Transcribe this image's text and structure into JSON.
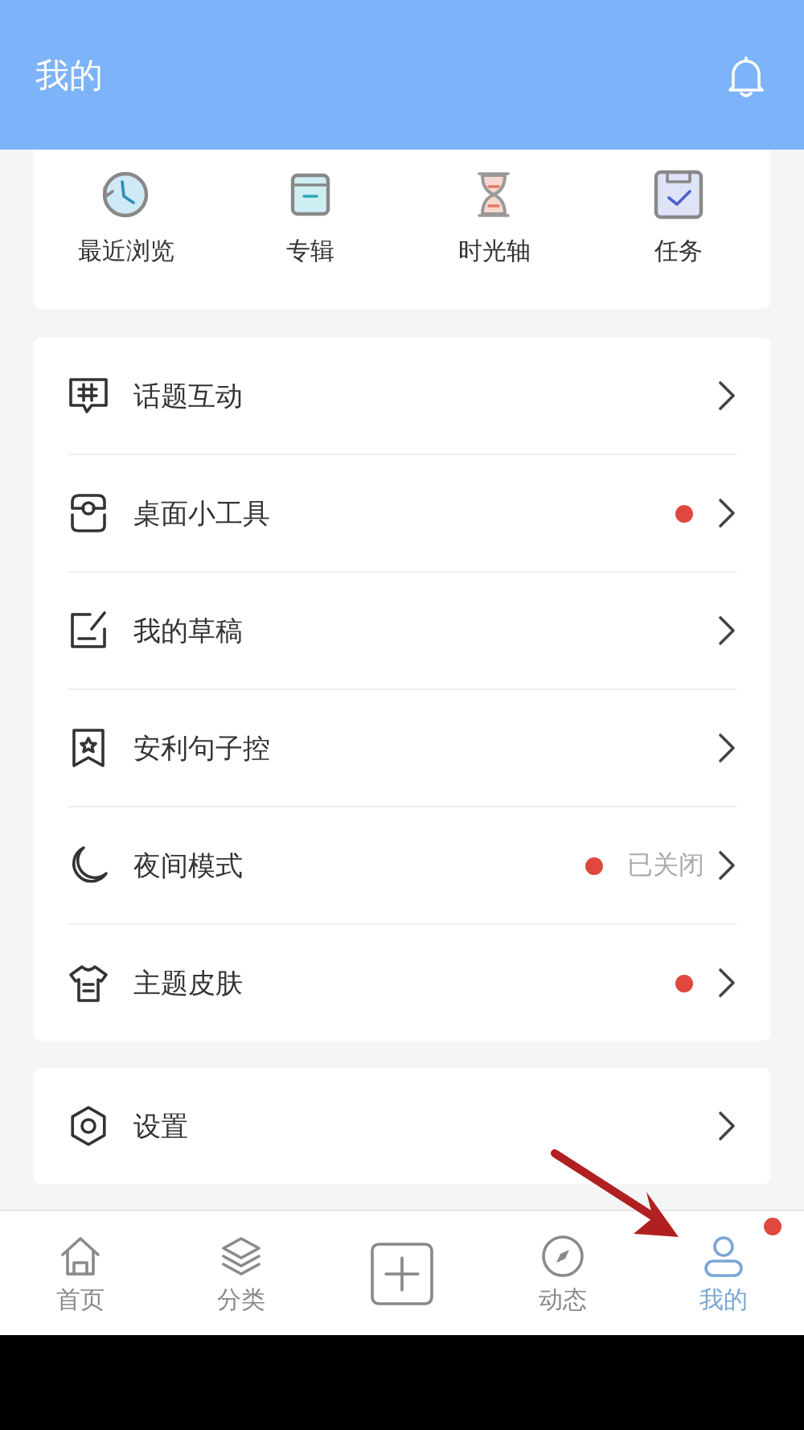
{
  "header": {
    "title": "我的"
  },
  "shortcuts": [
    {
      "label": "最近浏览",
      "kind": "history"
    },
    {
      "label": "专辑",
      "kind": "album"
    },
    {
      "label": "时光轴",
      "kind": "hourglass"
    },
    {
      "label": "任务",
      "kind": "task"
    }
  ],
  "menu": [
    {
      "label": "话题互动",
      "kind": "topic",
      "dot": false
    },
    {
      "label": "桌面小工具",
      "kind": "widget",
      "dot": true
    },
    {
      "label": "我的草稿",
      "kind": "draft",
      "dot": false
    },
    {
      "label": "安利句子控",
      "kind": "bookmark",
      "dot": false
    },
    {
      "label": "夜间模式",
      "kind": "moon",
      "dot": true,
      "status": "已关闭"
    },
    {
      "label": "主题皮肤",
      "kind": "shirt",
      "dot": true
    }
  ],
  "settings": [
    {
      "label": "设置",
      "kind": "gear",
      "dot": false
    }
  ],
  "tabs": [
    {
      "label": "首页",
      "kind": "home",
      "selected": false,
      "badge": false
    },
    {
      "label": "分类",
      "kind": "layers",
      "selected": false,
      "badge": false
    },
    {
      "kind": "plus",
      "selected": false,
      "badge": false
    },
    {
      "label": "动态",
      "kind": "compass",
      "selected": false,
      "badge": false
    },
    {
      "label": "我的",
      "kind": "person",
      "selected": true,
      "badge": true
    }
  ]
}
